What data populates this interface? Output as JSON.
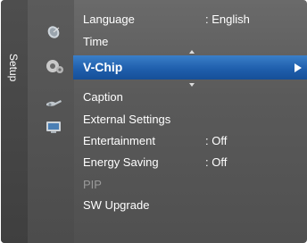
{
  "menu": {
    "category": "Setup",
    "items": [
      {
        "label": "Language",
        "value": ": English"
      },
      {
        "label": "Time",
        "value": ""
      },
      {
        "label": "V-Chip",
        "value": ""
      },
      {
        "label": "Caption",
        "value": ""
      },
      {
        "label": "External Settings",
        "value": ""
      },
      {
        "label": "Entertainment",
        "value": ": Off"
      },
      {
        "label": "Energy Saving",
        "value": ": Off"
      },
      {
        "label": "PIP",
        "value": ""
      },
      {
        "label": "SW Upgrade",
        "value": ""
      }
    ],
    "selected_index": 2
  },
  "icons": {
    "picture": "satellite-dish-icon",
    "setup": "gear-icon",
    "input": "plug-icon",
    "application": "tv-icon"
  },
  "colors": {
    "highlight": "#1f5fad",
    "panel": "#5a5a5a",
    "text": "#ffffff",
    "disabled": "#9a9a9a"
  }
}
